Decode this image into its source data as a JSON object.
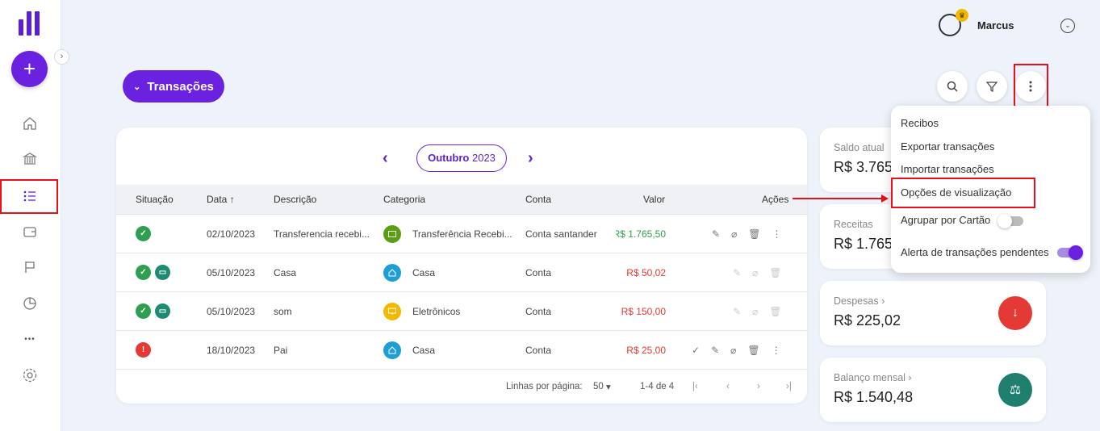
{
  "user": {
    "name": "Marcus"
  },
  "header": {
    "title": "Transações"
  },
  "nav": {
    "add": "+",
    "more": "•••"
  },
  "period": {
    "month": "Outubro",
    "year": "2023"
  },
  "table": {
    "headers": {
      "status": "Situação",
      "date": "Data",
      "desc": "Descrição",
      "cat": "Categoria",
      "account": "Conta",
      "value": "Valor",
      "actions": "Ações"
    },
    "rows": [
      {
        "date": "02/10/2023",
        "desc": "Transferencia recebi...",
        "cat": "Transferência Recebi...",
        "account": "Conta santander",
        "value": "R$ 1.765,50"
      },
      {
        "date": "05/10/2023",
        "desc": "Casa",
        "cat": "Casa",
        "account": "Conta",
        "value": "R$ 50,02"
      },
      {
        "date": "05/10/2023",
        "desc": "som",
        "cat": "Eletrônicos",
        "account": "Conta",
        "value": "R$ 150,00"
      },
      {
        "date": "18/10/2023",
        "desc": "Pai",
        "cat": "Casa",
        "account": "Conta",
        "value": "R$ 25,00"
      }
    ],
    "footer": {
      "rows_label": "Linhas por página:",
      "rows_value": "50",
      "range": "1-4 de 4"
    }
  },
  "cards": {
    "saldo": {
      "label": "Saldo atual",
      "value": "R$ 3.765"
    },
    "receitas": {
      "label": "Receitas",
      "value": "R$ 1.765"
    },
    "despesas": {
      "label": "Despesas",
      "value": "R$ 225,02"
    },
    "balanco": {
      "label": "Balanço mensal",
      "value": "R$ 1.540,48"
    }
  },
  "menu": {
    "recibos": "Recibos",
    "exportar": "Exportar transações",
    "importar": "Importar transações",
    "opcoes": "Opções de visualização",
    "agrupar": "Agrupar por Cartão",
    "alerta": "Alerta de transações pendentes"
  },
  "colors": {
    "accent": "#6a22e0",
    "green": "#2e9e4f",
    "red": "#e53935",
    "teal": "#1e7f6e"
  }
}
